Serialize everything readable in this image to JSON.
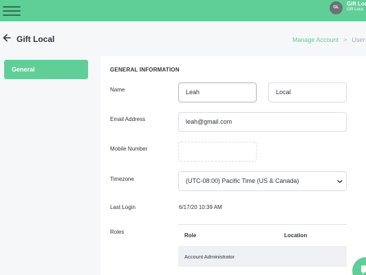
{
  "header": {
    "avatar_initials": "GL",
    "account_name": "Gift Loc",
    "account_sub": "Gift Loca",
    "brand_color": "#5fcf97"
  },
  "page": {
    "title": "Gift Local"
  },
  "breadcrumb": {
    "link": "Manage Account",
    "separator": ">",
    "current": "User D"
  },
  "sidebar": {
    "items": [
      {
        "label": "General",
        "active": true
      }
    ]
  },
  "form": {
    "section_title": "GENERAL INFORMATION",
    "name": {
      "label": "Name",
      "first": "Leah",
      "last": "Local"
    },
    "email": {
      "label": "Email Address",
      "value": "leah@gmail.com"
    },
    "mobile": {
      "label": "Mobile Number",
      "value": ""
    },
    "timezone": {
      "label": "Timezone",
      "value": "(UTC-08:00) Pacific Time (US & Canada)"
    },
    "last_login": {
      "label": "Last Login",
      "value": "6/17/20 10:39 AM"
    },
    "roles": {
      "label": "Roles",
      "columns": [
        "Role",
        "Location"
      ],
      "rows": [
        {
          "role": "Account Administrator",
          "location": ""
        }
      ]
    }
  },
  "icons": {
    "menu": "hamburger-icon",
    "back": "arrow-left-icon",
    "chevron": "chevron-down-icon",
    "chat": "chat-icon"
  }
}
